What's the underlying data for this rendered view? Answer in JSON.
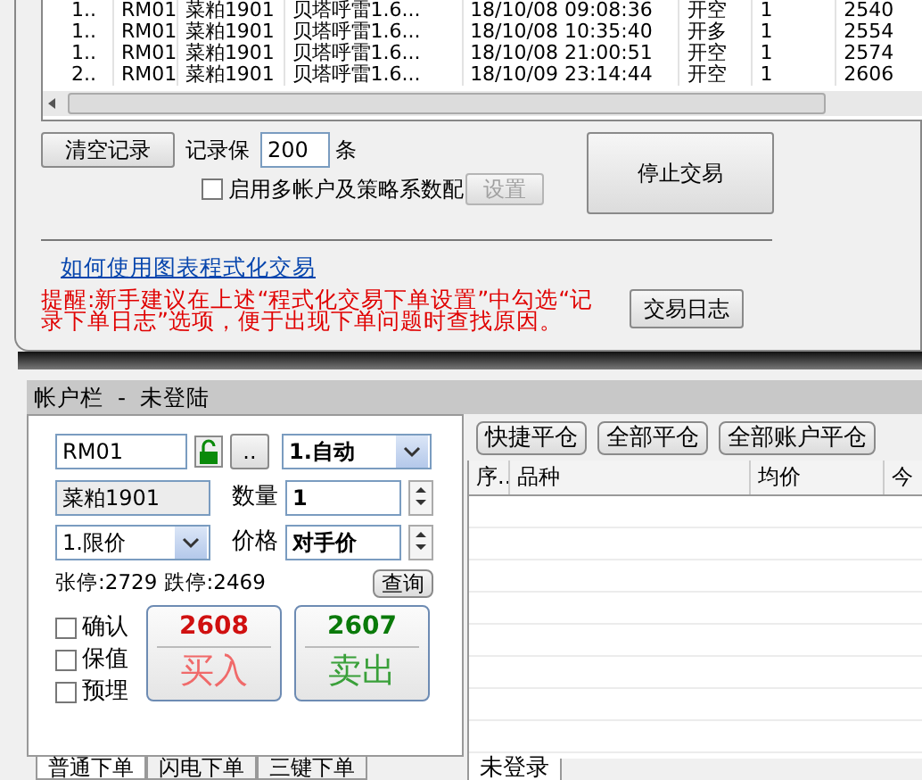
{
  "log_table": {
    "rows": [
      [
        "1..",
        "RM01",
        "菜粕1901",
        "贝塔呼雷1.6...",
        "18/10/08 09:08:36",
        "开空",
        "1",
        "2540"
      ],
      [
        "1..",
        "RM01",
        "菜粕1901",
        "贝塔呼雷1.6...",
        "18/10/08 10:35:40",
        "开多",
        "1",
        "2554"
      ],
      [
        "1..",
        "RM01",
        "菜粕1901",
        "贝塔呼雷1.6...",
        "18/10/08 21:00:51",
        "开空",
        "1",
        "2574"
      ],
      [
        "2..",
        "RM01",
        "菜粕1901",
        "贝塔呼雷1.6...",
        "18/10/09 23:14:44",
        "开空",
        "1",
        "2606"
      ]
    ]
  },
  "clear_button": "清空记录",
  "keep_label": "记录保",
  "keep_value": "200",
  "keep_unit": "条",
  "multi_account": {
    "label": "启用多帐户及策略系数配",
    "checked": false
  },
  "settings_button": {
    "label": "设置",
    "disabled": true
  },
  "stop_button": "停止交易",
  "help_link": "如何使用图表程式化交易",
  "warning": "提醒:新手建议在上述“程式化交易下单设置”中勾选“记录下单日志”选项，便于出现下单问题时查找原因。",
  "log_button": "交易日志",
  "account_bar": {
    "title": "帐户栏  -  未登陆"
  },
  "order_panel": {
    "contract": "RM01",
    "more_button": "..",
    "mode": "1.自动",
    "name": "菜粕1901",
    "qty_label": "数量",
    "qty": "1",
    "price_type": "1.限价",
    "price_label": "价格",
    "price": "对手价",
    "limits": "张停:2729 跌停:2469",
    "query_button": "查询",
    "options": [
      {
        "label": "确认",
        "checked": false
      },
      {
        "label": "保值",
        "checked": false
      },
      {
        "label": "预埋",
        "checked": false
      }
    ],
    "buy": {
      "price": "2608",
      "label": "买入"
    },
    "sell": {
      "price": "2607",
      "label": "卖出"
    }
  },
  "order_tabs": [
    {
      "label": "普通下单",
      "selected": true
    },
    {
      "label": "闪电下单",
      "selected": false
    },
    {
      "label": "三键下单",
      "selected": false
    }
  ],
  "position_buttons": [
    "快捷平仓",
    "全部平仓",
    "全部账户平仓"
  ],
  "position_table": {
    "columns": [
      "序..",
      "品种",
      "均价",
      "今"
    ]
  },
  "position_tabs": [
    {
      "label": "未登录",
      "selected": true
    }
  ]
}
